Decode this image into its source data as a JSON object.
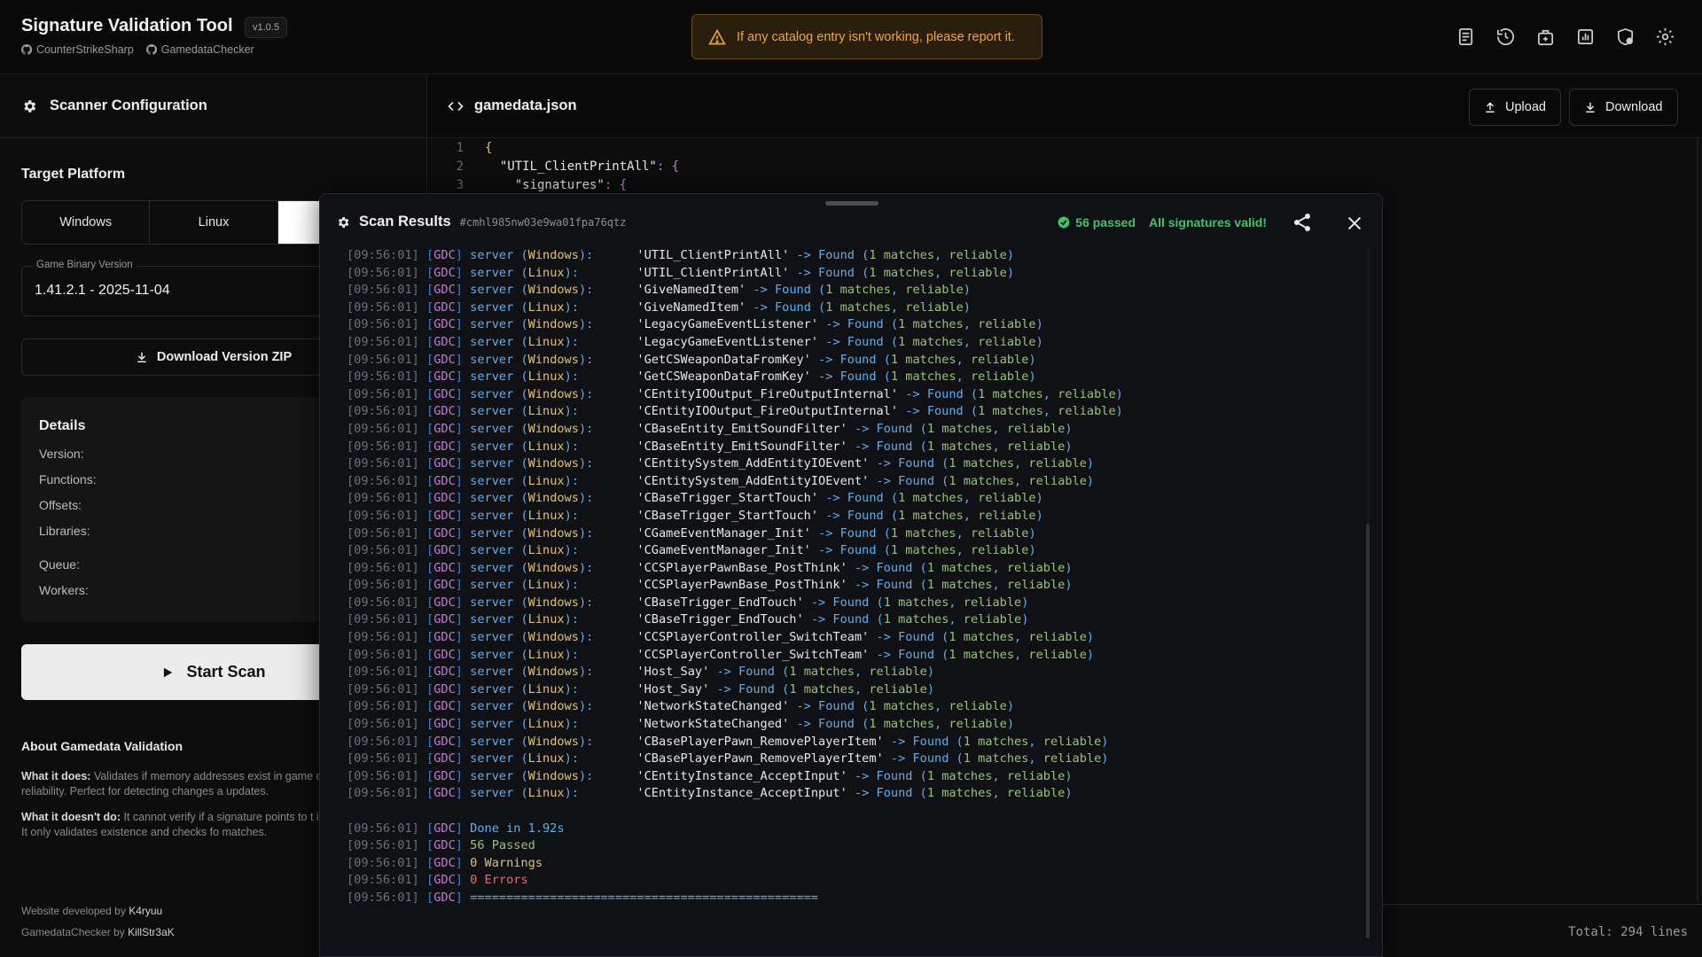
{
  "header": {
    "title": "Signature Validation Tool",
    "version": "v1.0.5",
    "links": [
      "CounterStrikeSharp",
      "GamedataChecker"
    ],
    "alert": "If any catalog entry isn't working, please report it.",
    "icons": [
      "docs-icon",
      "history-icon",
      "package-icon",
      "stats-icon",
      "shield-icon",
      "settings-icon"
    ]
  },
  "sidebar": {
    "title": "Scanner Configuration",
    "target_platform_label": "Target Platform",
    "platforms": [
      "Windows",
      "Linux",
      ""
    ],
    "active_platform_index": 2,
    "binary_version_label": "Game Binary Version",
    "binary_version_value": "1.41.2.1 - 2025-11-04",
    "download_zip_label": "Download Version ZIP",
    "details_title": "Details",
    "details": [
      "Version:",
      "Functions:",
      "Offsets:",
      "Libraries:"
    ],
    "details_extra": [
      "Queue:",
      "Workers:"
    ],
    "start_scan_label": "Start Scan",
    "about_title": "About Gamedata Validation",
    "about_does_label": "What it does:",
    "about_does_text": " Validates if memory addresses exist in game checks signature reliability. Perfect for detecting changes a updates.",
    "about_doesnt_label": "What it doesn't do:",
    "about_doesnt_text": " It cannot verify if a signature points to t intended function. It only validates existence and checks fo matches.",
    "credit1_prefix": "Website developed by ",
    "credit1_name": "K4ryuu",
    "credit2_prefix": "GamedataChecker by ",
    "credit2_name": "KillStr3aK"
  },
  "editor": {
    "file_name": "gamedata.json",
    "upload_label": "Upload",
    "download_label": "Download",
    "lines": [
      {
        "n": "1",
        "pre": "",
        "key": "{",
        "rest": ""
      },
      {
        "n": "2",
        "pre": "  ",
        "key": "\"UTIL_ClientPrintAll\"",
        "rest": ": {"
      },
      {
        "n": "3",
        "pre": "    ",
        "key": "\"signatures\"",
        "rest": ": {"
      }
    ],
    "footer": "Total: 294 lines"
  },
  "scan": {
    "title": "Scan Results",
    "id": "#cmhl985nw03e9wa01fpa76qtz",
    "passed": "56 passed",
    "valid_message": "All signatures valid!",
    "time": "[09:56:01]",
    "tag": "GDC",
    "entries": [
      {
        "platform": "Windows",
        "name": "UTIL_ClientPrintAll"
      },
      {
        "platform": "Linux",
        "name": "UTIL_ClientPrintAll"
      },
      {
        "platform": "Windows",
        "name": "GiveNamedItem"
      },
      {
        "platform": "Linux",
        "name": "GiveNamedItem"
      },
      {
        "platform": "Windows",
        "name": "LegacyGameEventListener"
      },
      {
        "platform": "Linux",
        "name": "LegacyGameEventListener"
      },
      {
        "platform": "Windows",
        "name": "GetCSWeaponDataFromKey"
      },
      {
        "platform": "Linux",
        "name": "GetCSWeaponDataFromKey"
      },
      {
        "platform": "Windows",
        "name": "CEntityIOOutput_FireOutputInternal"
      },
      {
        "platform": "Linux",
        "name": "CEntityIOOutput_FireOutputInternal"
      },
      {
        "platform": "Windows",
        "name": "CBaseEntity_EmitSoundFilter"
      },
      {
        "platform": "Linux",
        "name": "CBaseEntity_EmitSoundFilter"
      },
      {
        "platform": "Windows",
        "name": "CEntitySystem_AddEntityIOEvent"
      },
      {
        "platform": "Linux",
        "name": "CEntitySystem_AddEntityIOEvent"
      },
      {
        "platform": "Windows",
        "name": "CBaseTrigger_StartTouch"
      },
      {
        "platform": "Linux",
        "name": "CBaseTrigger_StartTouch"
      },
      {
        "platform": "Windows",
        "name": "CGameEventManager_Init"
      },
      {
        "platform": "Linux",
        "name": "CGameEventManager_Init"
      },
      {
        "platform": "Windows",
        "name": "CCSPlayerPawnBase_PostThink"
      },
      {
        "platform": "Linux",
        "name": "CCSPlayerPawnBase_PostThink"
      },
      {
        "platform": "Windows",
        "name": "CBaseTrigger_EndTouch"
      },
      {
        "platform": "Linux",
        "name": "CBaseTrigger_EndTouch"
      },
      {
        "platform": "Windows",
        "name": "CCSPlayerController_SwitchTeam"
      },
      {
        "platform": "Linux",
        "name": "CCSPlayerController_SwitchTeam"
      },
      {
        "platform": "Windows",
        "name": "Host_Say"
      },
      {
        "platform": "Linux",
        "name": "Host_Say"
      },
      {
        "platform": "Windows",
        "name": "NetworkStateChanged"
      },
      {
        "platform": "Linux",
        "name": "NetworkStateChanged"
      },
      {
        "platform": "Windows",
        "name": "CBasePlayerPawn_RemovePlayerItem"
      },
      {
        "platform": "Linux",
        "name": "CBasePlayerPawn_RemovePlayerItem"
      },
      {
        "platform": "Windows",
        "name": "CEntityInstance_AcceptInput"
      },
      {
        "platform": "Linux",
        "name": "CEntityInstance_AcceptInput"
      }
    ],
    "found_text": "Found",
    "matches_text": "1 matches",
    "reliable_text": "reliable",
    "summary": [
      {
        "text": "Done in 1.92s",
        "color": "blue"
      },
      {
        "text": "56 Passed",
        "color": "green"
      },
      {
        "text": "0 Warnings",
        "color": "yellow"
      },
      {
        "text": "0 Errors",
        "color": "red"
      },
      {
        "text": "================================================",
        "color": "blue"
      }
    ]
  },
  "colors": {
    "accent_green": "#3ec46d",
    "alert_orange": "#f0a63a",
    "tag_purple": "#c678dd"
  }
}
